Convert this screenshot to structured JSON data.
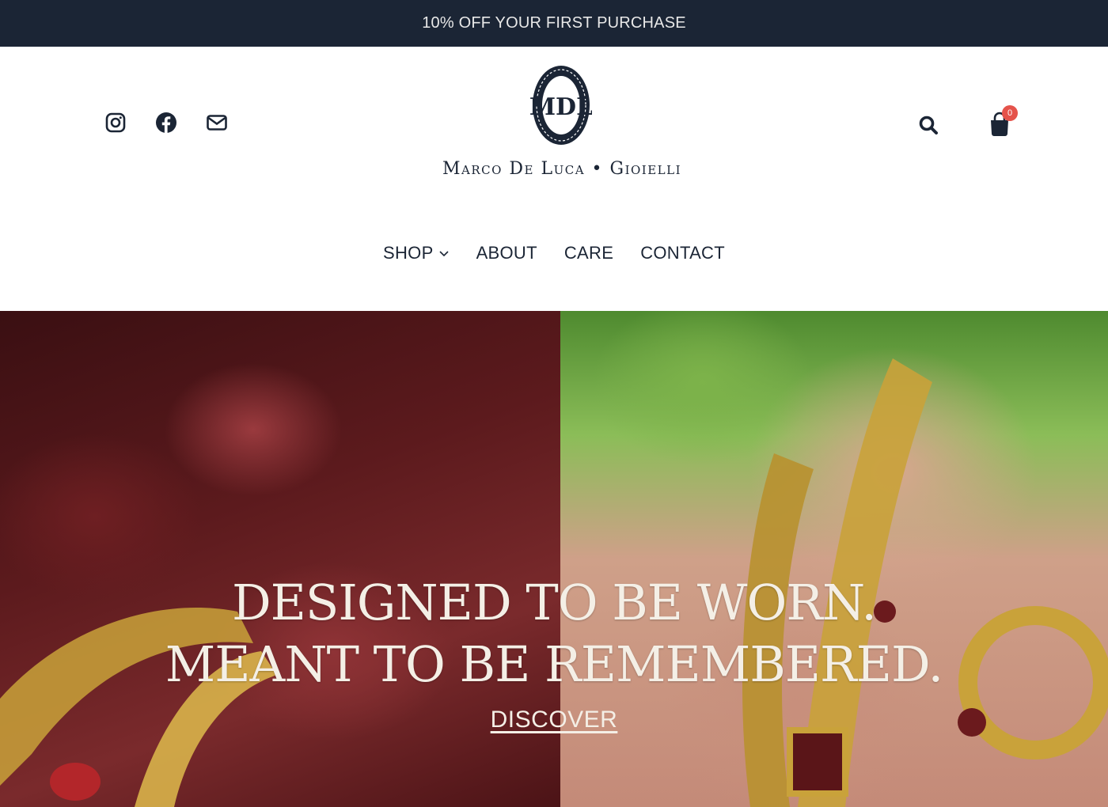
{
  "announcement": {
    "text": "10% OFF YOUR FIRST PURCHASE"
  },
  "header": {
    "social_icons": [
      "instagram-icon",
      "facebook-icon",
      "mail-icon"
    ],
    "logo_monogram": "MDL",
    "logo_text": "Marco De Luca • Gioielli",
    "cart_count": "0"
  },
  "nav": {
    "items": [
      {
        "label": "SHOP",
        "has_dropdown": true
      },
      {
        "label": "ABOUT"
      },
      {
        "label": "CARE"
      },
      {
        "label": "CONTACT"
      }
    ]
  },
  "hero": {
    "headline_line1": "DESIGNED TO BE WORN.",
    "headline_line2": "MEANT TO BE REMEMBERED.",
    "cta_label": "DISCOVER"
  },
  "colors": {
    "navy": "#1b2535",
    "badge_red": "#e5534b",
    "hero_text": "#f4efe6"
  }
}
